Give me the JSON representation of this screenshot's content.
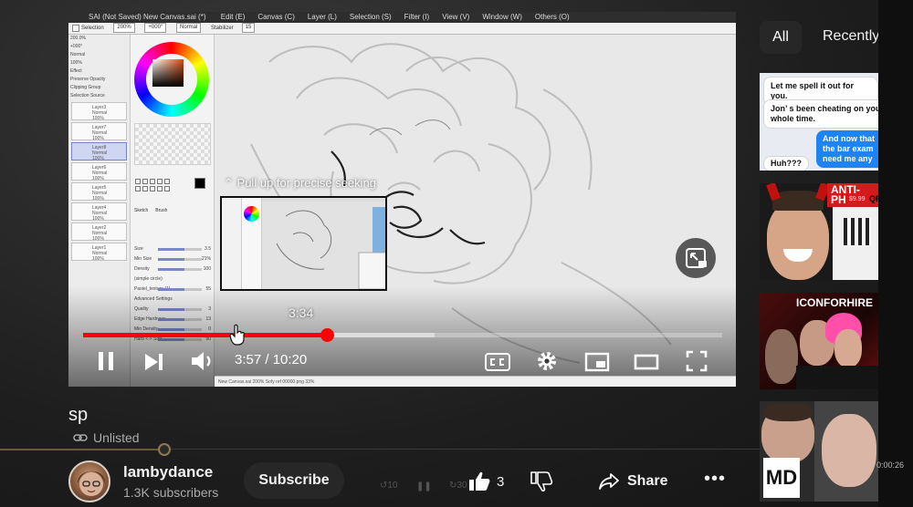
{
  "player": {
    "seek_hint": "Pull up for precise seeking",
    "seek_preview_time": "3:34",
    "current_time": "3:57 / 10:20",
    "progress_played_fraction": 0.382,
    "progress_buffered_fraction": 0.55,
    "controls": {
      "play_pause_icon": "pause-icon",
      "next_icon": "next-icon",
      "volume_icon": "volume-icon",
      "captions_icon": "captions-icon",
      "settings_icon": "gear-icon",
      "miniplayer_icon": "miniplayer-icon",
      "theater_icon": "theater-icon",
      "fullscreen_icon": "fullscreen-icon"
    },
    "sai": {
      "menubar_text": "SAI   (Not Saved) New Canvas.sai (*)",
      "menu_items": [
        "Edit (E)",
        "Canvas (C)",
        "Layer (L)",
        "Selection (S)",
        "Filter (I)",
        "View (V)",
        "Window (W)",
        "Others (O)"
      ],
      "toolbar": {
        "selection_label": "Selection",
        "zoom": "200%",
        "rotation": "+000°",
        "blend": "Normal",
        "stabilizer_label": "Stabilizer",
        "stabilizer_value": "15"
      },
      "left_panel_rows": [
        "200.0%",
        "+000°",
        "Normal",
        "100%",
        "Effect",
        "Preserve Opacity",
        "Clipping Group",
        "Selection Source"
      ],
      "layers": [
        {
          "name": "Layer3",
          "mode": "Normal",
          "opacity": "100%",
          "active": false
        },
        {
          "name": "Layer7",
          "mode": "Normal",
          "opacity": "100%",
          "active": false
        },
        {
          "name": "Layer8",
          "mode": "Normal",
          "opacity": "100%",
          "active": true
        },
        {
          "name": "Layer6",
          "mode": "Normal",
          "opacity": "100%",
          "active": false
        },
        {
          "name": "Layer5",
          "mode": "Normal",
          "opacity": "100%",
          "active": false
        },
        {
          "name": "Layer4",
          "mode": "Normal",
          "opacity": "100%",
          "active": false
        },
        {
          "name": "Layer2",
          "mode": "Normal",
          "opacity": "100%",
          "active": false
        },
        {
          "name": "Layer1",
          "mode": "Normal",
          "opacity": "100%",
          "active": false
        }
      ],
      "tool_rows": [
        {
          "label": "Size",
          "value": "3.5"
        },
        {
          "label": "Min Size",
          "value": "21%"
        },
        {
          "label": "Density",
          "value": "100"
        },
        {
          "label": "(simple circle)",
          "value": ""
        },
        {
          "label": "Pastel_texture (1)",
          "value": "55"
        },
        {
          "label": "Advanced Settings",
          "value": ""
        },
        {
          "label": "Quality",
          "value": "3"
        },
        {
          "label": "Edge Hardness",
          "value": "13"
        },
        {
          "label": "Min Density",
          "value": "0"
        },
        {
          "label": "Hard <-> Soft",
          "value": "90"
        }
      ],
      "tool_names": [
        "Sketch",
        "Brush"
      ],
      "status_text": "New Canvas.sai   200%   Sofy ref 00000.png   33%"
    }
  },
  "video": {
    "title": "sp",
    "privacy": "Unlisted"
  },
  "channel": {
    "name": "lambydance",
    "subscribers": "1.3K subscribers",
    "subscribe_label": "Subscribe"
  },
  "actions": {
    "like_count": "3",
    "share_label": "Share",
    "more_label": "•••",
    "rewind_label": "10",
    "forward_label": "30"
  },
  "rail": {
    "chips": [
      "All",
      "Recently"
    ],
    "thumb1": {
      "bubble1": "Let me spell it out for you.",
      "bubble2": "Jon’ s been cheating on you whole time.",
      "bubble3": "And now that the bar exam need me any",
      "bubble4": "Huh???"
    },
    "thumb2": {
      "banner": "ANTI-PH",
      "price": "$9.99",
      "qr_label": "QR"
    },
    "thumb3": {
      "banner": "ICONFORHIRE"
    },
    "thumb4": {
      "logo": "MD"
    },
    "time_fragment": "0:00:26"
  },
  "colors": {
    "progress_played": "#ff0000",
    "background": "#0f0f0f",
    "chip_active": "#272727"
  }
}
